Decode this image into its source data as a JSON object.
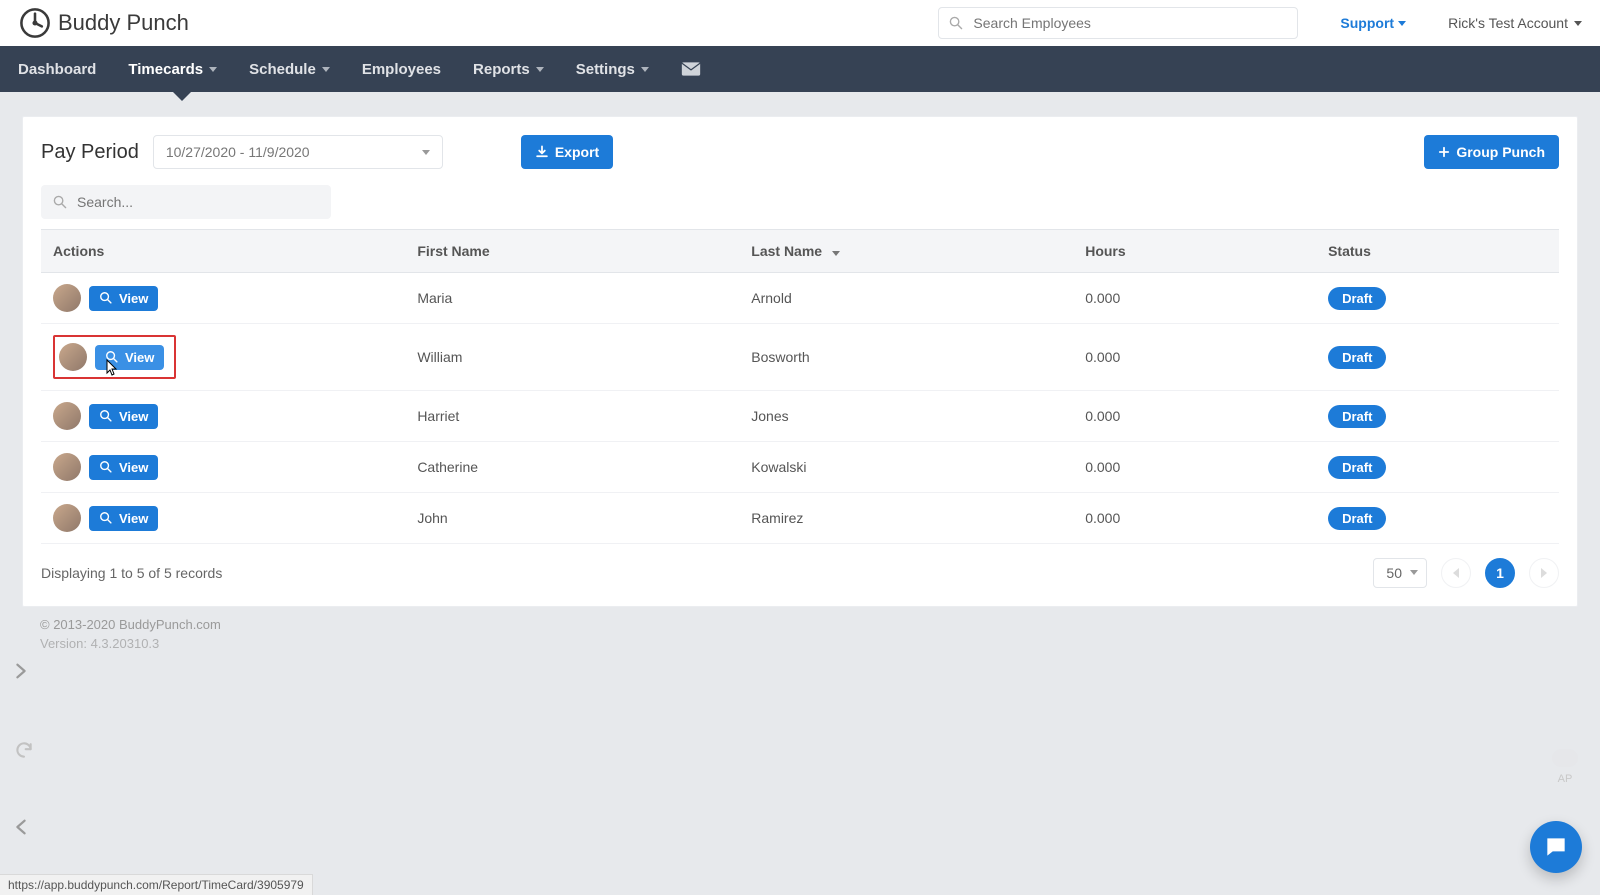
{
  "brand": {
    "name": "Buddy Punch"
  },
  "topbar": {
    "search_placeholder": "Search Employees",
    "support_label": "Support",
    "account_label": "Rick's Test Account"
  },
  "nav": {
    "items": [
      {
        "label": "Dashboard",
        "has_chevron": false,
        "active": false
      },
      {
        "label": "Timecards",
        "has_chevron": true,
        "active": true
      },
      {
        "label": "Schedule",
        "has_chevron": true,
        "active": false
      },
      {
        "label": "Employees",
        "has_chevron": false,
        "active": false
      },
      {
        "label": "Reports",
        "has_chevron": true,
        "active": false
      },
      {
        "label": "Settings",
        "has_chevron": true,
        "active": false
      }
    ]
  },
  "toolbar": {
    "pay_period_label": "Pay Period",
    "pay_period_value": "10/27/2020 - 11/9/2020",
    "export_label": "Export",
    "group_punch_label": "Group Punch"
  },
  "table": {
    "search_placeholder": "Search...",
    "view_button_label": "View",
    "columns": {
      "actions": "Actions",
      "first_name": "First Name",
      "last_name": "Last Name",
      "hours": "Hours",
      "status": "Status"
    },
    "rows": [
      {
        "first_name": "Maria",
        "last_name": "Arnold",
        "hours": "0.000",
        "status": "Draft",
        "highlighted": false
      },
      {
        "first_name": "William",
        "last_name": "Bosworth",
        "hours": "0.000",
        "status": "Draft",
        "highlighted": true
      },
      {
        "first_name": "Harriet",
        "last_name": "Jones",
        "hours": "0.000",
        "status": "Draft",
        "highlighted": false
      },
      {
        "first_name": "Catherine",
        "last_name": "Kowalski",
        "hours": "0.000",
        "status": "Draft",
        "highlighted": false
      },
      {
        "first_name": "John",
        "last_name": "Ramirez",
        "hours": "0.000",
        "status": "Draft",
        "highlighted": false
      }
    ]
  },
  "pager": {
    "summary": "Displaying 1 to 5 of 5 records",
    "page_size": "50",
    "current_page": "1"
  },
  "footer": {
    "copyright": "© 2013-2020 BuddyPunch.com",
    "version": "Version: 4.3.20310.3"
  },
  "misc": {
    "status_url": "https://app.buddypunch.com/Report/TimeCard/3905979",
    "right_widget_label": "AP"
  }
}
